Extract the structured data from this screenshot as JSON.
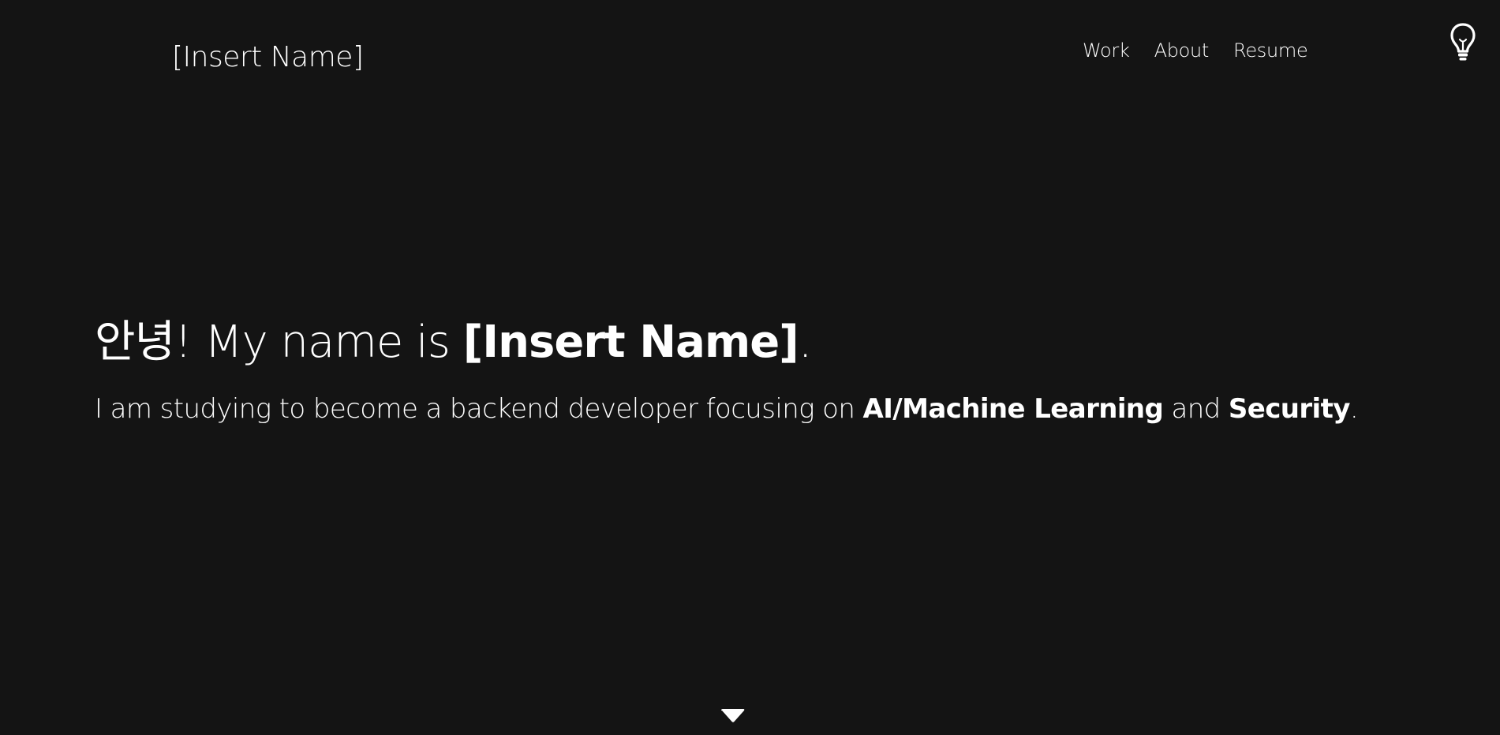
{
  "header": {
    "brand": "[Insert Name]",
    "nav": [
      {
        "label": "Work"
      },
      {
        "label": "About"
      },
      {
        "label": "Resume"
      }
    ],
    "theme_toggle_icon": "lightbulb-icon"
  },
  "hero": {
    "title": {
      "greeting": "안녕! My name is ",
      "name": "[Insert Name]",
      "end": "."
    },
    "subtitle": {
      "intro": "I am studying to become a backend developer focusing on ",
      "focus1": "AI/Machine Learning",
      "joiner": " and ",
      "focus2": "Security",
      "end": "."
    }
  },
  "scroll_icon": "chevron-down-icon",
  "colors": {
    "background": "#141414",
    "text": "#ffffff"
  }
}
